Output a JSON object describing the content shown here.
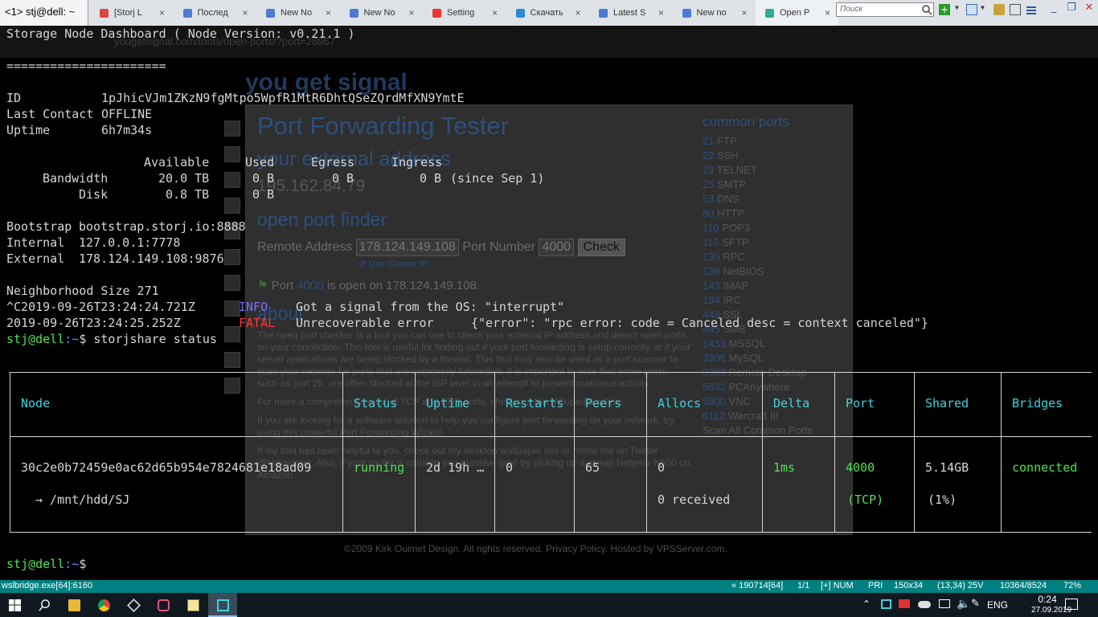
{
  "window": {
    "console_tab_label": "<1> stj@dell: ~",
    "browser_tabs": [
      {
        "label": "[Storj L",
        "color": "#d44"
      },
      {
        "label": "Послед",
        "color": "#4a7cd4"
      },
      {
        "label": "New No",
        "color": "#4a7cd4"
      },
      {
        "label": "New No",
        "color": "#4a7cd4"
      },
      {
        "label": "Setting",
        "color": "#e33"
      },
      {
        "label": "Скачать",
        "color": "#2a8ad4"
      },
      {
        "label": "Latest S",
        "color": "#4a7cd4"
      },
      {
        "label": "New no",
        "color": "#4a7cd4"
      },
      {
        "label": "Open P",
        "color": "#3a9"
      }
    ],
    "search_placeholder": "Поиск"
  },
  "background_page": {
    "url": "yougetsignal.com/tools/open-ports/?port=28967",
    "logo": "you get signal",
    "title": "Port Forwarding Tester",
    "external_heading": "your external address",
    "external_ip": "195.162.84.79",
    "finder_heading": "open port finder",
    "remote_label": "Remote Address",
    "remote_value": "178.124.149.108",
    "port_label": "Port Number",
    "port_value": "4000",
    "check_button": "Check",
    "use_current_ip": "Use Current IP",
    "open_status_pre": "Port",
    "open_status_port": "4000",
    "open_status_post": "is open on 178.124.149.108.",
    "about_heading": "about",
    "paragraphs": [
      "The open port checker is a tool you can use to check your external IP address and detect open ports on your connection. This tool is useful for finding out if your port forwarding is setup correctly or if your server applications are being blocked by a firewall. This tool may also be used as a port scanner to scan your network for ports that are commonly forwarded. It is important to note that some ports, such as port 25, are often blocked at the ISP level in an attempt to prevent malicious activity.",
      "For more a comprehensive list of TCP and UDP ports, check out this Wikipedia article.",
      "If you are looking for a software solution to help you configure port forwarding on your network, try using this powerful Port Forwarding Wizard.",
      "If my tool has been helpful to you, check out my desktop wallpaper site or follow me on Twitter @kirkouimet. Also, if your router is causing you massive grief try picking up a cheap Netgear N600 on Amazon."
    ],
    "common_ports_heading": "common ports",
    "common_ports": [
      {
        "num": "21",
        "name": "FTP"
      },
      {
        "num": "22",
        "name": "SSH"
      },
      {
        "num": "23",
        "name": "TELNET"
      },
      {
        "num": "25",
        "name": "SMTP"
      },
      {
        "num": "53",
        "name": "DNS"
      },
      {
        "num": "80",
        "name": "HTTP"
      },
      {
        "num": "110",
        "name": "POP3"
      },
      {
        "num": "115",
        "name": "SFTP"
      },
      {
        "num": "135",
        "name": "RPC"
      },
      {
        "num": "139",
        "name": "NetBIOS"
      },
      {
        "num": "143",
        "name": "IMAP"
      },
      {
        "num": "194",
        "name": "IRC"
      },
      {
        "num": "443",
        "name": "SSL"
      },
      {
        "num": "445",
        "name": "SMB"
      },
      {
        "num": "1433",
        "name": "MSSQL"
      },
      {
        "num": "3306",
        "name": "MySQL"
      },
      {
        "num": "3389",
        "name": "Remote Desktop"
      },
      {
        "num": "5632",
        "name": "PCAnywhere"
      },
      {
        "num": "5900",
        "name": "VNC"
      },
      {
        "num": "6112",
        "name": "Warcraft III"
      }
    ],
    "scan_all": "Scan All Common Ports",
    "footer": "©2009 Kirk Ouimet Design. All rights reserved. Privacy Policy. Hosted by VPSServer.com."
  },
  "terminal": {
    "header": "Storage Node Dashboard ( Node Version: v0.21.1 )",
    "separator": "======================",
    "id_label": "ID",
    "id_value": "1pJhicVJm1ZKzN9fgMtpo5WpfR1MtR6DhtQSeZQrdMfXN9YmtE",
    "last_contact_label": "Last Contact",
    "last_contact_value": "OFFLINE",
    "uptime_label": "Uptime",
    "uptime_value": "6h7m34s",
    "usage_headers": {
      "available": "Available",
      "used": "Used",
      "egress": "Egress",
      "ingress": "Ingress"
    },
    "bandwidth": {
      "label": "Bandwidth",
      "available": "20.0 TB",
      "used": "0 B",
      "egress": "0 B",
      "ingress": "0 B",
      "since": "(since Sep 1)"
    },
    "disk": {
      "label": "Disk",
      "available": "0.8 TB",
      "used": "0 B"
    },
    "bootstrap_label": "Bootstrap",
    "bootstrap_value": "bootstrap.storj.io:8888",
    "internal_label": "Internal",
    "internal_value": "127.0.0.1:7778",
    "external_label": "External",
    "external_value": "178.124.149.108:9876",
    "neighborhood": "Neighborhood Size 271",
    "log1": {
      "ts": "^C2019-09-26T23:24:24.721Z",
      "level": "INFO",
      "msg": "Got a signal from the OS: \"interrupt\""
    },
    "log2": {
      "ts": "2019-09-26T23:24:25.252Z",
      "level": "FATAL",
      "msg": "Unrecoverable error",
      "detail": "{\"error\": \"rpc error: code = Canceled desc = context canceled\"}"
    },
    "prompt_user": "stj@dell",
    "prompt_path": ":~",
    "prompt_symbol": "$",
    "command": "storjshare status",
    "table": {
      "headers": [
        "Node",
        "Status",
        "Uptime",
        "Restarts",
        "Peers",
        "Allocs",
        "Delta",
        "Port",
        "Shared",
        "Bridges"
      ],
      "row1": {
        "node": "30c2e0b72459e0ac62d65b954e7824681e18ad09",
        "status": "running",
        "uptime": "2d 19h …",
        "restarts": "0",
        "peers": "65",
        "allocs": "0",
        "delta": "1ms",
        "port": "4000",
        "shared": "5.14GB",
        "bridges": "connected"
      },
      "row2": {
        "node": "→ /mnt/hdd/SJ",
        "allocs": "0 received",
        "port": "(TCP)",
        "shared": "(1%)"
      }
    },
    "final_prompt_user": "stj@dell",
    "final_prompt_path": ":~",
    "final_prompt_symbol": "$"
  },
  "statusbar": {
    "process": "wslbridge.exe[64]:6160",
    "build": "« 190714[64]",
    "pages": "1/1",
    "locks": "[+] NUM",
    "priority": "PRI",
    "size": "150x34",
    "cursor": "(13,34) 25V",
    "buffer": "10364/8524",
    "zoom": "72%"
  },
  "taskbar": {
    "language": "ENG",
    "time": "0:24",
    "date": "27.09.2019"
  }
}
